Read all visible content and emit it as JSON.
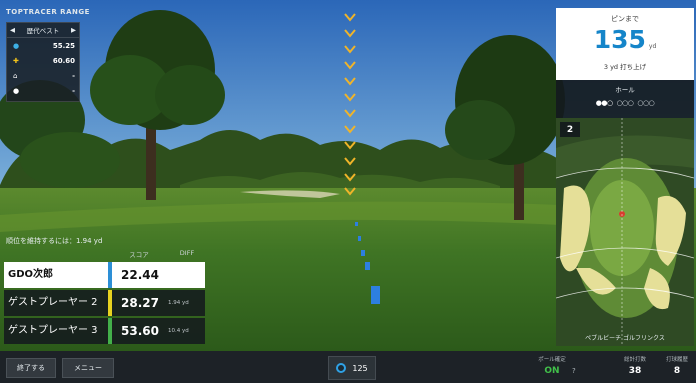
{
  "brand": "TOPTRACER RANGE",
  "best_panel": {
    "title": "歴代ベスト",
    "rows": [
      {
        "icon": "globe-icon",
        "value": "55.25"
      },
      {
        "icon": "sweden-flag-icon",
        "value": "60.60"
      },
      {
        "icon": "home-icon",
        "value": "-"
      },
      {
        "icon": "person-icon",
        "value": "-"
      }
    ]
  },
  "pin": {
    "label": "ピンまで",
    "distance": "135",
    "unit": "yd",
    "sub": "3 yd 打ち上げ"
  },
  "hole_selector": {
    "label": "ホール",
    "groups": [
      "●●○",
      "○○○",
      "○○○"
    ]
  },
  "hole_number": "2",
  "course_name": "ペブルビーチ ゴルフリンクス",
  "prompt": "順位を維持するには：1.94 yd",
  "score_headers": {
    "score": "スコア",
    "diff": "DIFF"
  },
  "players": [
    {
      "name": "GDO次郎",
      "score": "22.44",
      "diff": "",
      "color": "#2d8fd6",
      "highlight": true
    },
    {
      "name": "ゲストプレーヤー 2",
      "score": "28.27",
      "diff": "1.94 yd",
      "color": "#e7d320",
      "highlight": false
    },
    {
      "name": "ゲストプレーヤー 3",
      "score": "53.60",
      "diff": "10.4 yd",
      "color": "#43b04a",
      "highlight": false
    }
  ],
  "bottom": {
    "end_button": "終了する",
    "menu_button": "メニュー",
    "ball_count": "125",
    "stats": [
      {
        "label": "ポール確定",
        "value": "ON",
        "value_color": "#41c04a"
      },
      {
        "label": "総計打数",
        "value": "38"
      },
      {
        "label": "打球履歴",
        "value": "8"
      }
    ]
  },
  "colors": {
    "accent": "#1585c9",
    "ui_dark": "#1d2227"
  }
}
